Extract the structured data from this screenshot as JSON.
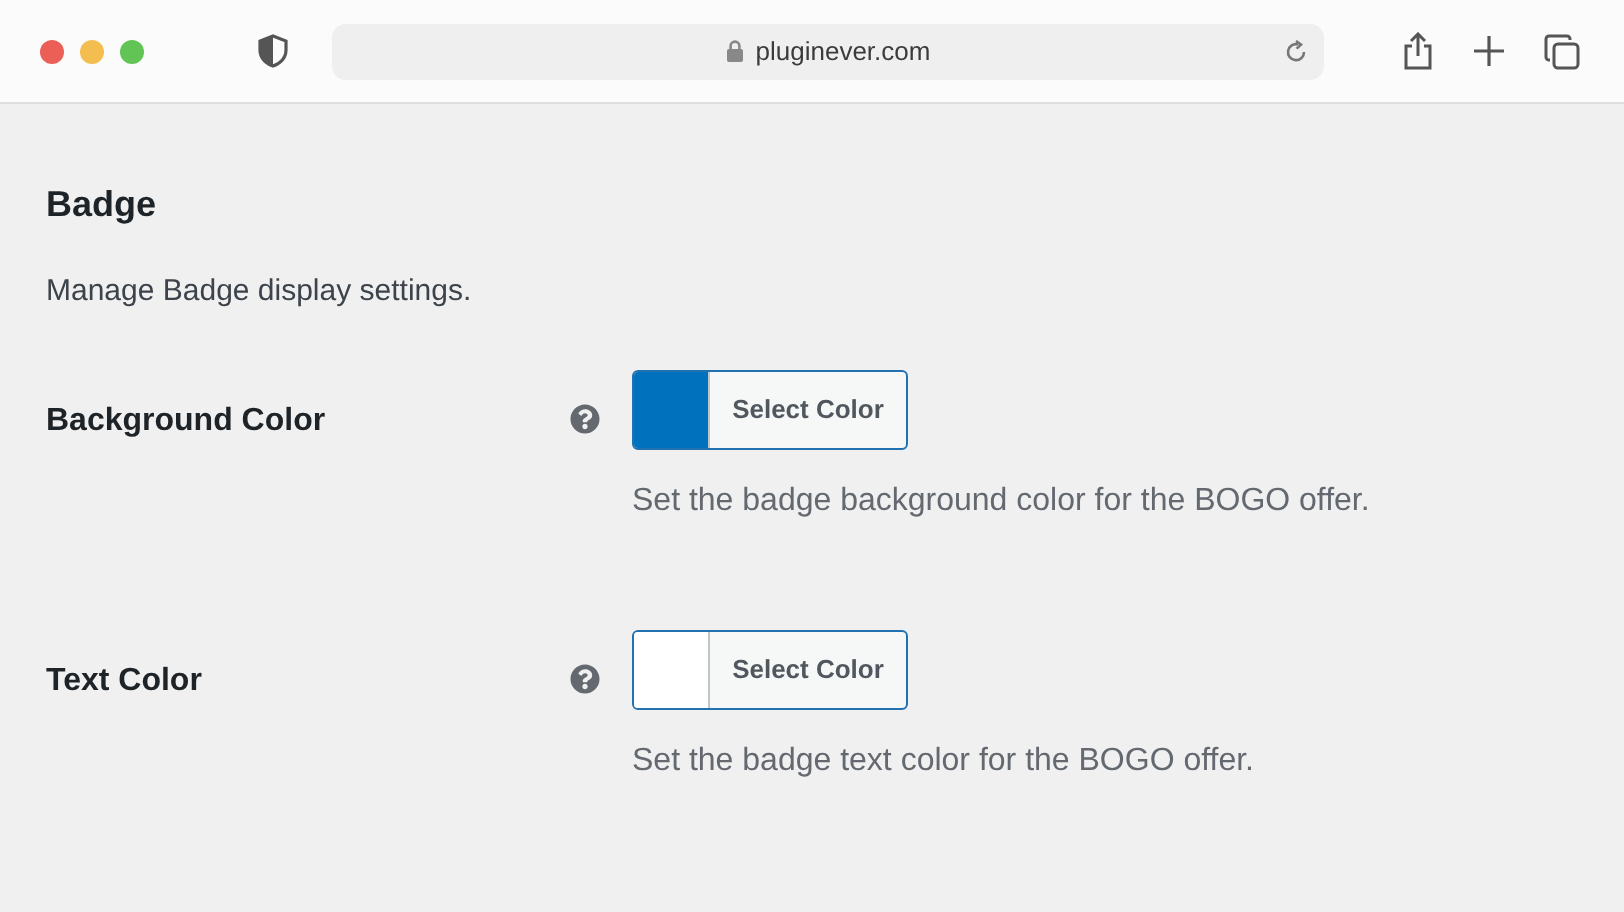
{
  "browser": {
    "url": "pluginever.com"
  },
  "section": {
    "title": "Badge",
    "description": "Manage Badge display settings."
  },
  "fields": [
    {
      "label": "Background Color",
      "color": "#0071bc",
      "button": "Select Color",
      "help": "Set the badge background color for the BOGO offer."
    },
    {
      "label": "Text Color",
      "color": "#ffffff",
      "button": "Select Color",
      "help": "Set the badge text color for the BOGO offer."
    }
  ]
}
